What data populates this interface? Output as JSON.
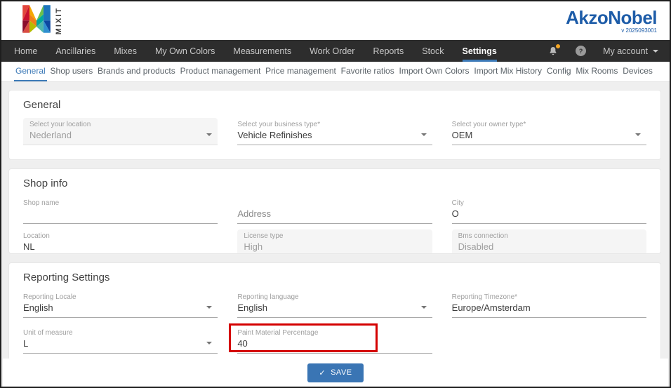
{
  "header": {
    "logo_text": "MIXIT",
    "brand": "AkzoNobel",
    "version": "v 2025093001"
  },
  "navbar": {
    "items": [
      "Home",
      "Ancillaries",
      "Mixes",
      "My Own Colors",
      "Measurements",
      "Work Order",
      "Reports",
      "Stock",
      "Settings"
    ],
    "active_item": "Settings",
    "account_label": "My account",
    "help_glyph": "?"
  },
  "tabs": {
    "items": [
      "General",
      "Shop users",
      "Brands and products",
      "Product management",
      "Price management",
      "Favorite ratios",
      "Import Own Colors",
      "Import Mix History",
      "Config",
      "Mix Rooms",
      "Devices"
    ],
    "active_tab": "General"
  },
  "sections": {
    "general": {
      "title": "General",
      "fields": [
        {
          "label": "Select your location",
          "value": "Nederland",
          "disabled": true
        },
        {
          "label": "Select your business type*",
          "value": "Vehicle Refinishes"
        },
        {
          "label": "Select your owner type*",
          "value": "OEM"
        }
      ]
    },
    "shop_info": {
      "title": "Shop info",
      "fields": [
        {
          "label": "Shop name",
          "value": ""
        },
        {
          "label": "",
          "placeholder": "Address",
          "value": ""
        },
        {
          "label": "City",
          "value": "O"
        },
        {
          "label": "Location",
          "value": "NL"
        },
        {
          "label": "License type",
          "value": "High",
          "disabled": true
        },
        {
          "label": "Bms connection",
          "value": "Disabled",
          "disabled": true
        }
      ]
    },
    "reporting": {
      "title": "Reporting Settings",
      "fields": [
        {
          "label": "Reporting Locale",
          "value": "English"
        },
        {
          "label": "Reporting language",
          "value": "English"
        },
        {
          "label": "Reporting Timezone*",
          "value": "Europe/Amsterdam"
        },
        {
          "label": "Unit of measure",
          "value": "L"
        },
        {
          "label": "Paint Material Percentage",
          "value": "40",
          "highlighted": true
        }
      ]
    }
  },
  "footer": {
    "save_label": "SAVE",
    "save_icon": "✓"
  },
  "colors": {
    "brand_blue": "#1d5ca8",
    "nav_background": "#2d2d2d",
    "active_accent": "#3d7ab7",
    "save_button": "#3a75b4",
    "highlight_red": "#d40000",
    "notification_orange": "#f5a623"
  }
}
